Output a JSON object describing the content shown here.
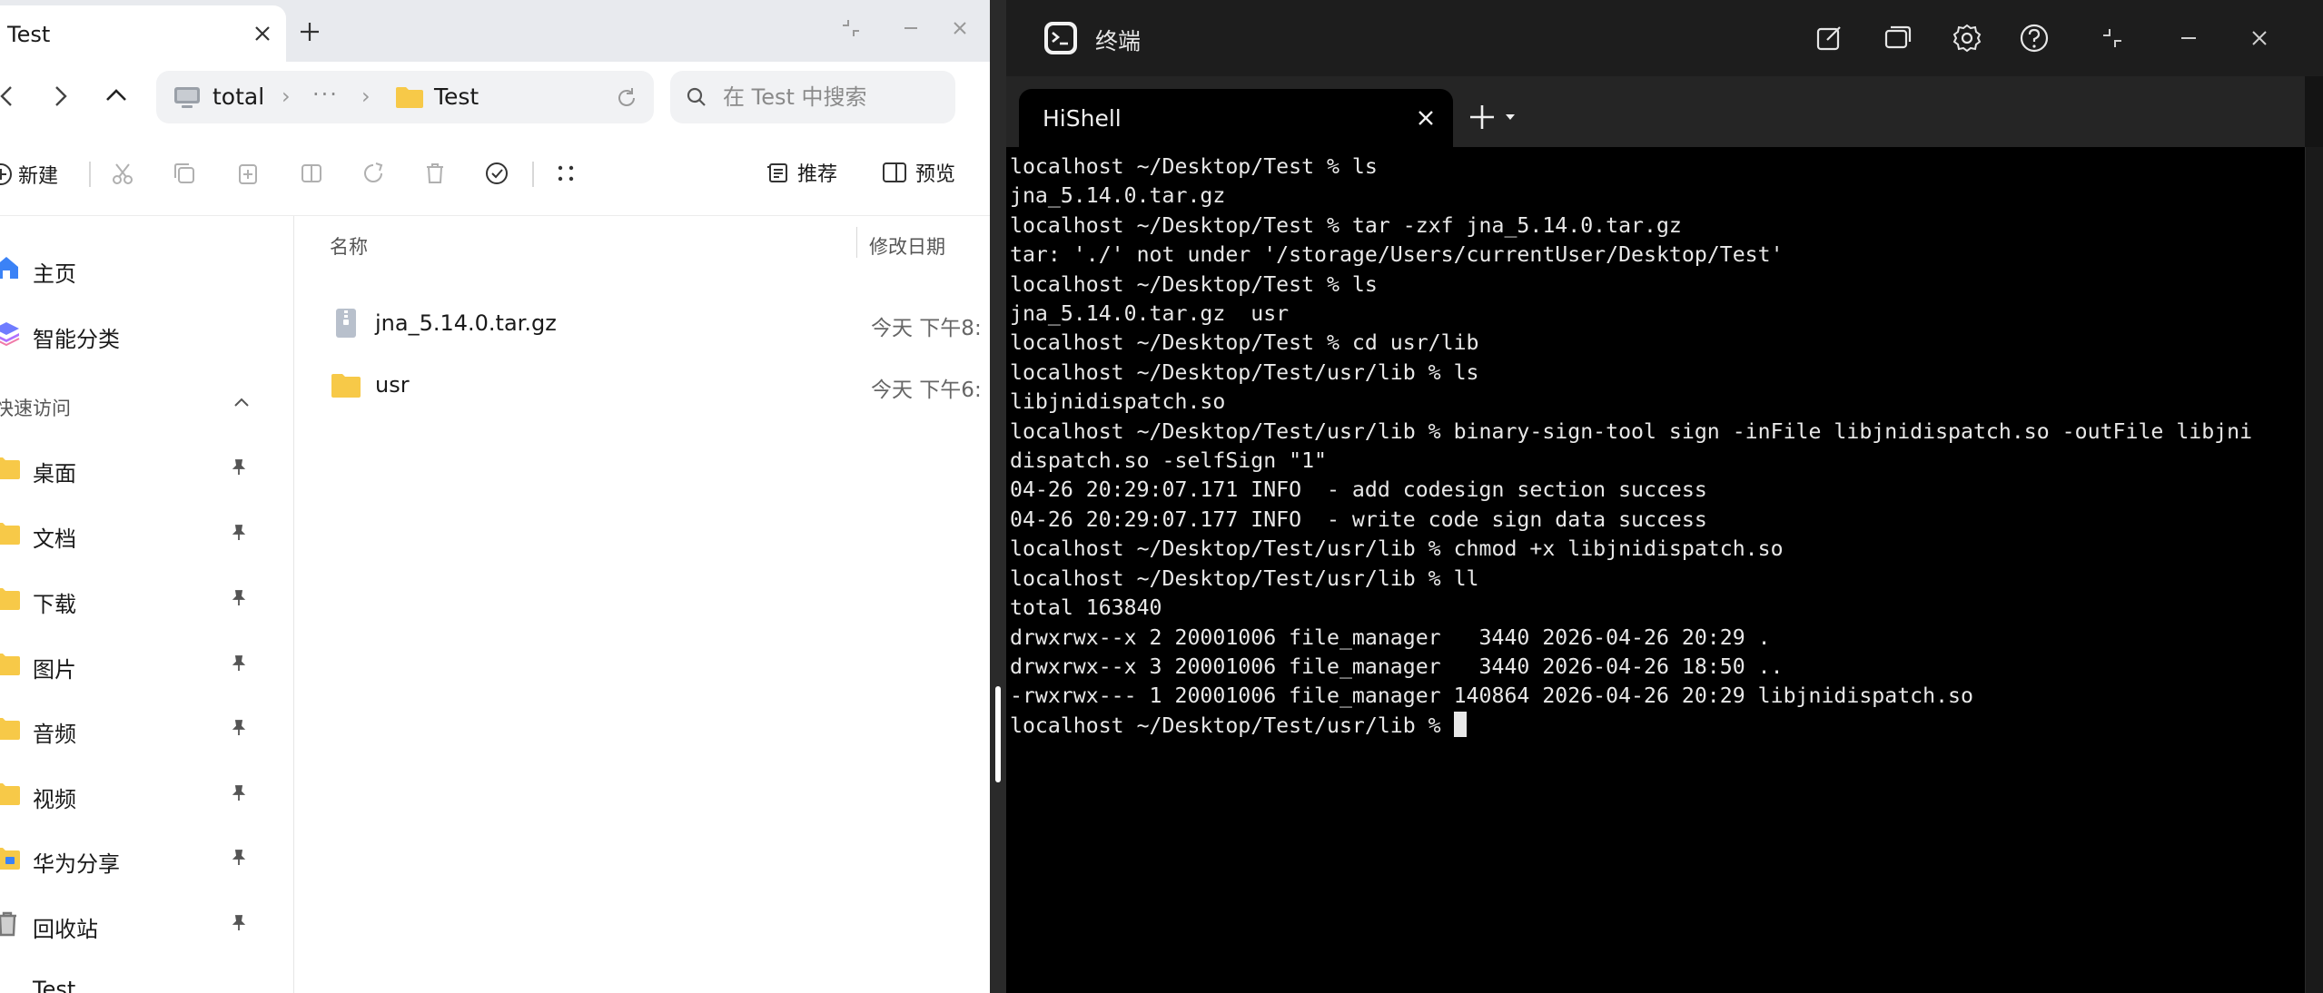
{
  "file_manager": {
    "tab_title": "Test",
    "address": {
      "root": "total",
      "ellipsis": "···",
      "current": "Test"
    },
    "search": {
      "placeholder": "在 Test 中搜索"
    },
    "toolbar": {
      "new_label": "新建",
      "recommend_label": "推荐",
      "preview_label": "预览"
    },
    "sidebar": {
      "home": "主页",
      "smart": "智能分类",
      "quick_access": "快速访问",
      "items": [
        {
          "label": "桌面"
        },
        {
          "label": "文档"
        },
        {
          "label": "下载"
        },
        {
          "label": "图片"
        },
        {
          "label": "音频"
        },
        {
          "label": "视频"
        },
        {
          "label": "华为分享"
        },
        {
          "label": "回收站"
        },
        {
          "label": "Test"
        }
      ]
    },
    "columns": {
      "name": "名称",
      "date": "修改日期"
    },
    "files": [
      {
        "name": "jna_5.14.0.tar.gz",
        "date": "今天 下午8:"
      },
      {
        "name": "usr",
        "date": "今天 下午6:"
      }
    ]
  },
  "terminal": {
    "window_title": "终端",
    "tab_title": "HiShell",
    "lines": [
      "localhost ~/Desktop/Test % ls",
      "jna_5.14.0.tar.gz",
      "localhost ~/Desktop/Test % tar -zxf jna_5.14.0.tar.gz",
      "tar: './' not under '/storage/Users/currentUser/Desktop/Test'",
      "localhost ~/Desktop/Test % ls",
      "jna_5.14.0.tar.gz  usr",
      "localhost ~/Desktop/Test % cd usr/lib",
      "localhost ~/Desktop/Test/usr/lib % ls",
      "libjnidispatch.so",
      "localhost ~/Desktop/Test/usr/lib % binary-sign-tool sign -inFile libjnidispatch.so -outFile libjni",
      "dispatch.so -selfSign \"1\"",
      "04-26 20:29:07.171 INFO  - add codesign section success",
      "04-26 20:29:07.177 INFO  - write code sign data success",
      "localhost ~/Desktop/Test/usr/lib % chmod +x libjnidispatch.so",
      "localhost ~/Desktop/Test/usr/lib % ll",
      "total 163840",
      "drwxrwx--x 2 20001006 file_manager   3440 2026-04-26 20:29 .",
      "drwxrwx--x 3 20001006 file_manager   3440 2026-04-26 18:50 ..",
      "-rwxrwx--- 1 20001006 file_manager 140864 2026-04-26 20:29 libjnidispatch.so"
    ],
    "prompt": "localhost ~/Desktop/Test/usr/lib % "
  },
  "colors": {
    "folder": "#f7c948",
    "accent_blue": "#3b82f6",
    "terminal_bg": "#000000"
  }
}
